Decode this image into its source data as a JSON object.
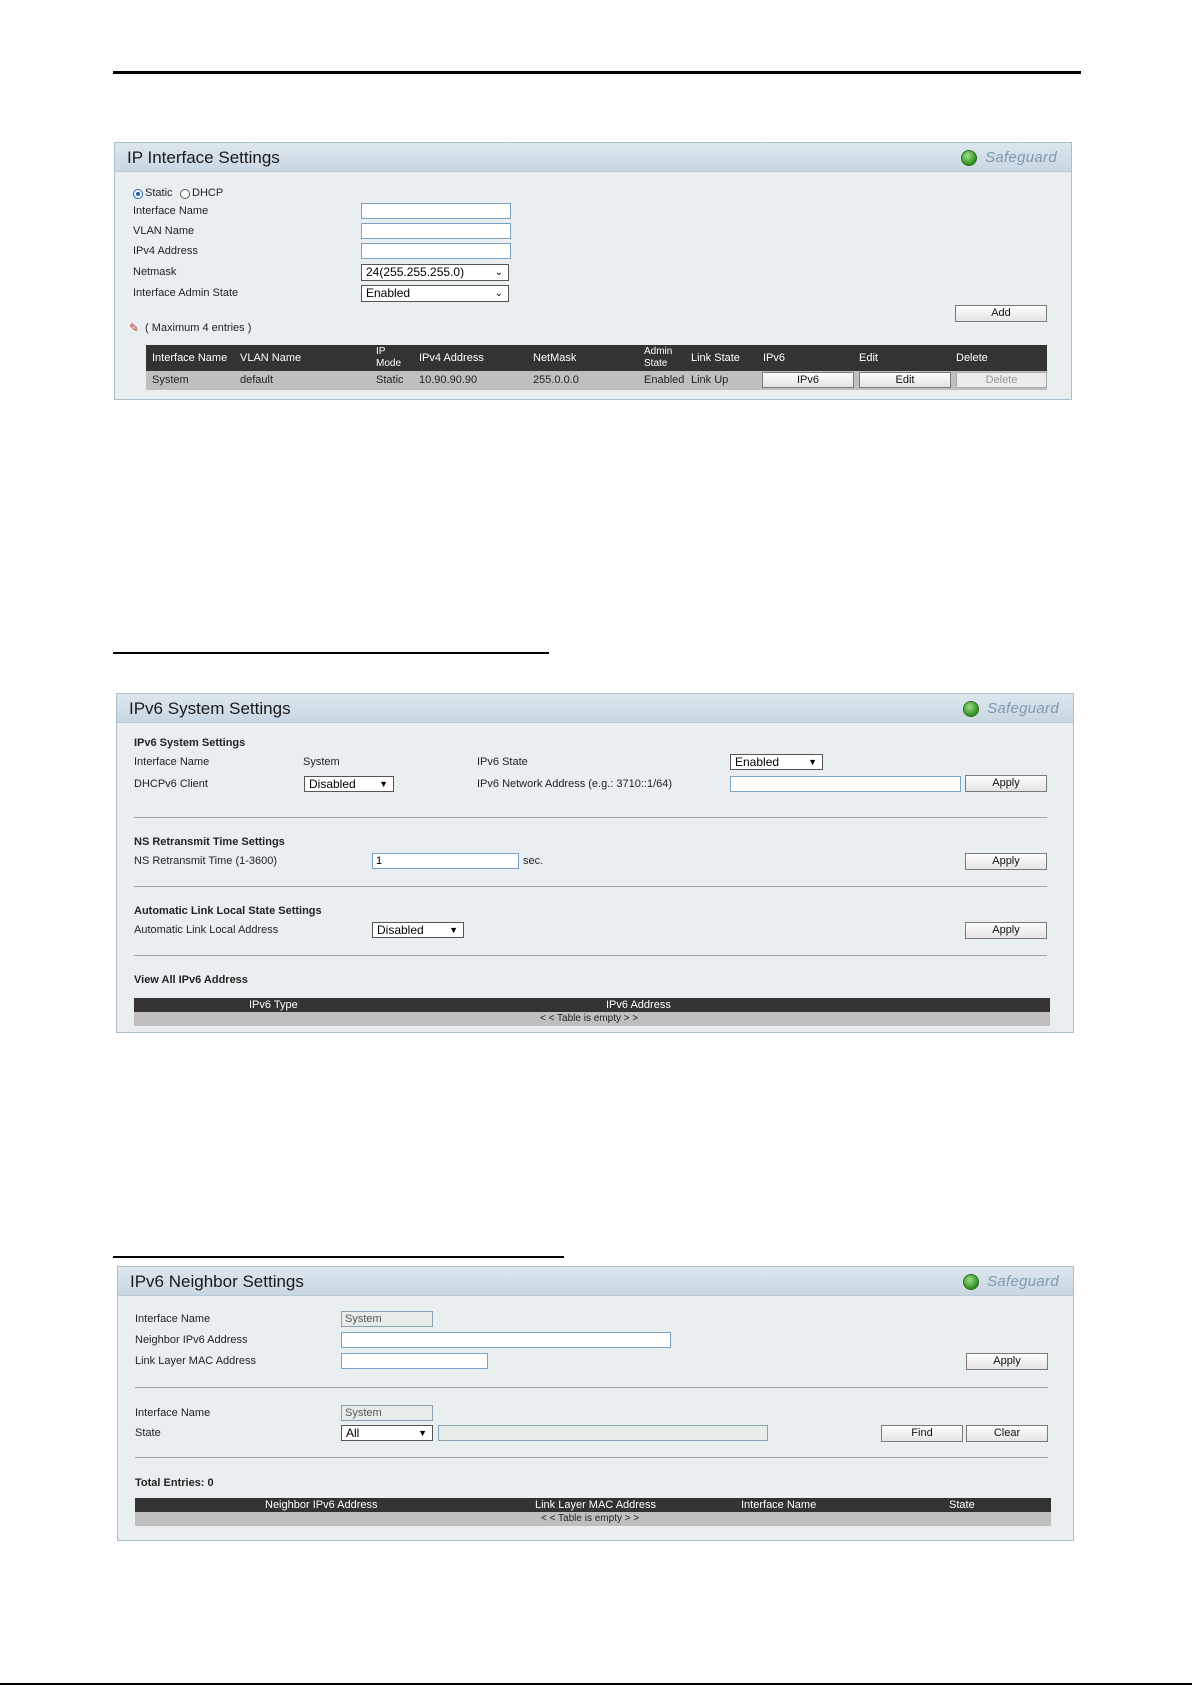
{
  "ip_interface": {
    "title": "IP Interface Settings",
    "safeguard": "Safeguard",
    "radio_static": "Static",
    "radio_dhcp": "DHCP",
    "fields": {
      "interface_name": "Interface Name",
      "vlan_name": "VLAN Name",
      "ipv4_address": "IPv4 Address",
      "netmask": "Netmask",
      "admin_state": "Interface Admin State"
    },
    "netmask_value": "24(255.255.255.0)",
    "admin_state_value": "Enabled",
    "add_button": "Add",
    "max_entries": "( Maximum 4 entries )",
    "table": {
      "headers": {
        "interface_name": "Interface Name",
        "vlan_name": "VLAN Name",
        "ip_mode_1": "IP",
        "ip_mode_2": "Mode",
        "ipv4": "IPv4 Address",
        "netmask": "NetMask",
        "admin_1": "Admin",
        "admin_2": "State",
        "link": "Link State",
        "ipv6": "IPv6",
        "edit": "Edit",
        "delete": "Delete"
      },
      "row": {
        "interface_name": "System",
        "vlan_name": "default",
        "ip_mode": "Static",
        "ipv4": "10.90.90.90",
        "netmask": "255.0.0.0",
        "admin": "Enabled",
        "link": "Link Up",
        "ipv6_btn": "IPv6",
        "edit_btn": "Edit",
        "delete_btn": "Delete"
      }
    }
  },
  "ipv6_system": {
    "title": "IPv6 System Settings",
    "safeguard": "Safeguard",
    "section1": "IPv6 System Settings",
    "interface_name_label": "Interface Name",
    "interface_name_value": "System",
    "ipv6_state_label": "IPv6 State",
    "ipv6_state_value": "Enabled",
    "dhcpv6_label": "DHCPv6 Client",
    "dhcpv6_value": "Disabled",
    "net_addr_label": "IPv6 Network Address (e.g.: 3710::1/64)",
    "apply1": "Apply",
    "section2": "NS Retransmit Time Settings",
    "ns_label": "NS Retransmit Time (1-3600)",
    "ns_value": "1",
    "ns_unit": "sec.",
    "apply2": "Apply",
    "section3": "Automatic Link Local State Settings",
    "auto_label": "Automatic Link Local Address",
    "auto_value": "Disabled",
    "apply3": "Apply",
    "section4": "View All IPv6 Address",
    "col_type": "IPv6 Type",
    "col_addr": "IPv6 Address",
    "empty": "< < Table is empty > >"
  },
  "ipv6_neighbor": {
    "title": "IPv6 Neighbor Settings",
    "safeguard": "Safeguard",
    "interface_name_label": "Interface Name",
    "interface_name_value": "System",
    "neighbor_label": "Neighbor IPv6 Address",
    "mac_label": "Link Layer MAC Address",
    "apply": "Apply",
    "interface_name_label2": "Interface Name",
    "interface_name_value2": "System",
    "state_label": "State",
    "state_value": "All",
    "find": "Find",
    "clear": "Clear",
    "total": "Total Entries: 0",
    "col_neighbor": "Neighbor IPv6 Address",
    "col_mac": "Link Layer MAC Address",
    "col_iface": "Interface Name",
    "col_state": "State",
    "empty": "< < Table is empty > >"
  }
}
